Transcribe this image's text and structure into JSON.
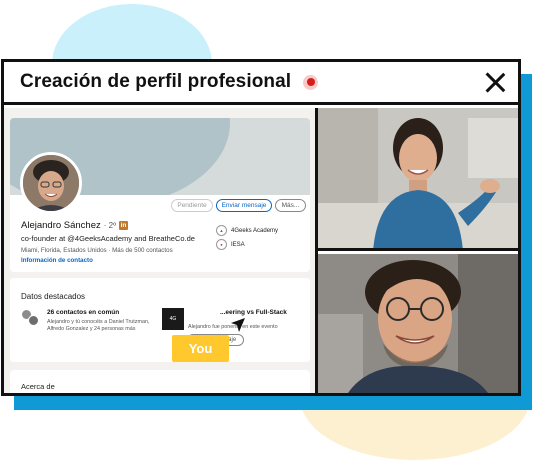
{
  "window": {
    "title": "Creación de perfil profesional"
  },
  "profile": {
    "buttons": {
      "pending": "Pendiente",
      "message": "Enviar mensaje",
      "more": "Más..."
    },
    "name": "Alejandro Sánchez",
    "degree": "· 2º",
    "headline": "co-founder at @4GeeksAcademy and BreatheCo.de",
    "location": "Miami, Florida, Estados Unidos · Más de 500 contactos",
    "contact_info": "Información de contacto",
    "education": [
      {
        "name": "4Geeks Academy"
      },
      {
        "name": "IESA"
      }
    ]
  },
  "highlights": {
    "title": "Datos destacados",
    "mutual_title": "26 contactos en común",
    "mutual_sub": "Alejandro y tú conocéis a Daniel Trutzman, Alfredo Gonzalez y 24 personas más",
    "event_title": "...eering vs Full-Stack",
    "event_sub": "Alejandro fue ponente en este evento",
    "event_button": "Enviar mensaje"
  },
  "you_label": "You",
  "about": {
    "title": "Acerca de"
  },
  "colors": {
    "accent_blue": "#0f9ad6",
    "link_blue": "#0a66c2",
    "you_yellow": "#ffc82c",
    "record_red": "#d51d1d"
  }
}
